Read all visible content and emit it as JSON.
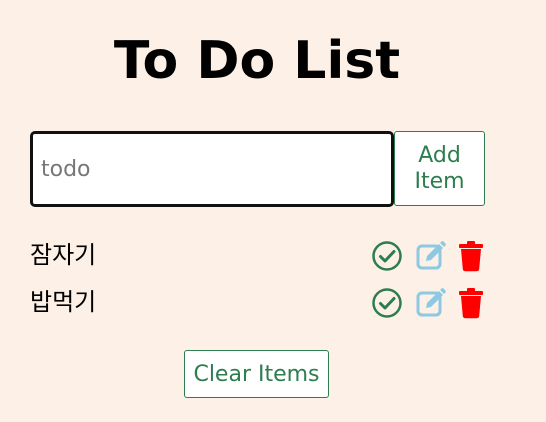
{
  "page": {
    "title": "To Do List"
  },
  "form": {
    "input_placeholder": "todo",
    "input_value": "",
    "add_button_label": "Add\nItem"
  },
  "items": [
    {
      "text": "잠자기",
      "icons": [
        "check-circle-icon",
        "edit-icon",
        "trash-icon"
      ]
    },
    {
      "text": "밥먹기",
      "icons": [
        "check-circle-icon",
        "edit-icon",
        "trash-icon"
      ]
    }
  ],
  "footer": {
    "clear_button_label": "Clear Items"
  },
  "colors": {
    "background": "#fdf0e6",
    "accent_green": "#2e7d4f",
    "edit_blue": "#8ec9e4",
    "delete_red": "#ff0000"
  }
}
